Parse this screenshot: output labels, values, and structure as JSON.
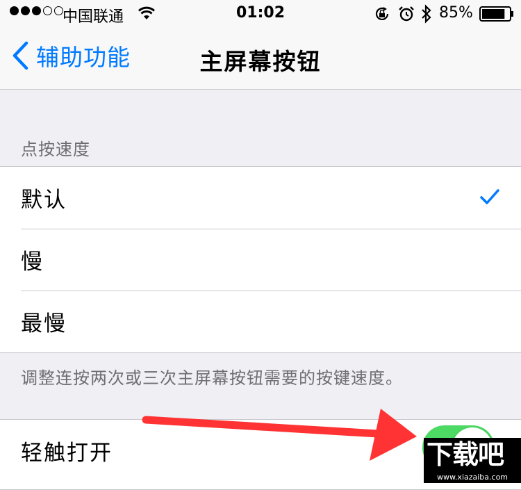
{
  "status_bar": {
    "signal_filled": 3,
    "signal_total": 5,
    "carrier": "中国联通",
    "time": "01:02",
    "battery_percent": "85%",
    "battery_level": 0.85
  },
  "nav": {
    "back_label": "辅助功能",
    "title": "主屏幕按钮"
  },
  "speed_section": {
    "header": "点按速度",
    "options": [
      {
        "label": "默认",
        "selected": true
      },
      {
        "label": "慢",
        "selected": false
      },
      {
        "label": "最慢",
        "selected": false
      }
    ],
    "footer": "调整连按两次或三次主屏幕按钮需要的按键速度。"
  },
  "touch_section": {
    "label": "轻触打开",
    "toggle_on": true
  },
  "watermark": {
    "logo_text": "下载吧",
    "url": "www.xiazaiba.com"
  },
  "colors": {
    "accent": "#007aff",
    "toggle_on": "#4cd964",
    "arrow": "#ff3333",
    "background": "#efeff4"
  }
}
